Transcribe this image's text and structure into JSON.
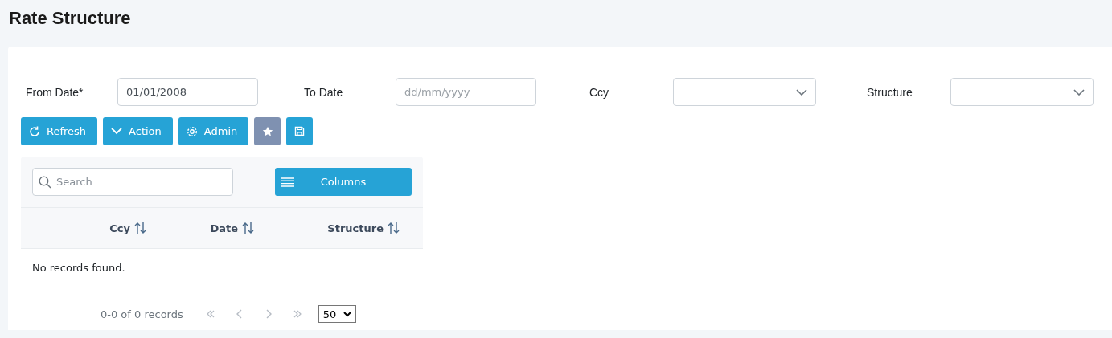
{
  "page_title": "Rate Structure",
  "filters": [
    {
      "label": "From Date*",
      "kind": "text",
      "value": "01/01/2008"
    },
    {
      "label": "To Date",
      "kind": "text",
      "placeholder": "dd/mm/yyyy"
    },
    {
      "label": "Ccy",
      "kind": "select"
    },
    {
      "label": "Structure",
      "kind": "select"
    }
  ],
  "toolbar": [
    {
      "kind": "refresh",
      "label": "Refresh"
    },
    {
      "kind": "action",
      "label": "Action"
    },
    {
      "kind": "admin",
      "label": "Admin"
    },
    {
      "kind": "favorite"
    },
    {
      "kind": "save"
    }
  ],
  "table": {
    "search": {
      "placeholder": "Search"
    },
    "columns_button": "Columns",
    "columns": [
      "Ccy",
      "Date",
      "Structure"
    ],
    "empty_message": "No records found.",
    "paginator": {
      "summary": "0-0 of 0 records",
      "nav": [
        {
          "kind": "first",
          "disabled": true
        },
        {
          "kind": "prev",
          "disabled": true
        },
        {
          "kind": "next",
          "disabled": true
        },
        {
          "kind": "last",
          "disabled": true
        }
      ],
      "page_size": "50"
    }
  }
}
